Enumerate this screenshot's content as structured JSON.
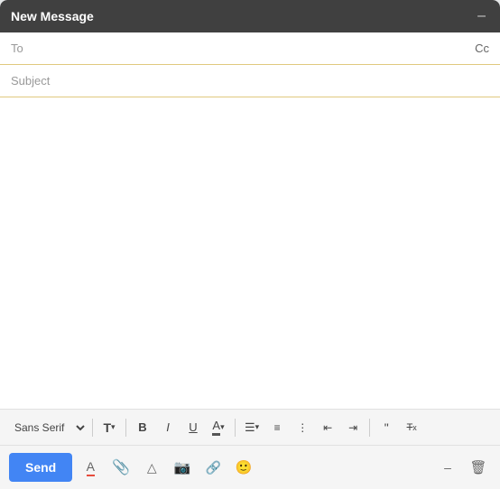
{
  "titleBar": {
    "title": "New Message",
    "minimizeLabel": "–"
  },
  "fields": {
    "toLabel": "To",
    "toPlaceholder": "",
    "ccLabel": "Cc",
    "subjectLabel": "Subject",
    "subjectPlaceholder": ""
  },
  "toolbar": {
    "fontFamily": "Sans Serif",
    "formatDropdownLabel": "T",
    "boldLabel": "B",
    "italicLabel": "I",
    "underlineLabel": "U",
    "fontColorLabel": "A",
    "alignLabel": "≡",
    "numberedListLabel": "1.",
    "bulletListLabel": "•",
    "indentMoreLabel": "→",
    "indentLessLabel": "←",
    "quoteLabel": "❝",
    "removeFormattingLabel": "Tx"
  },
  "bottomBar": {
    "sendLabel": "Send",
    "fontColorIcon": "A",
    "attachIcon": "📎",
    "driveIcon": "△",
    "photoIcon": "📷",
    "linkIcon": "🔗",
    "emojiIcon": "😊",
    "minimizeIcon": "–",
    "trashIcon": "🗑"
  }
}
